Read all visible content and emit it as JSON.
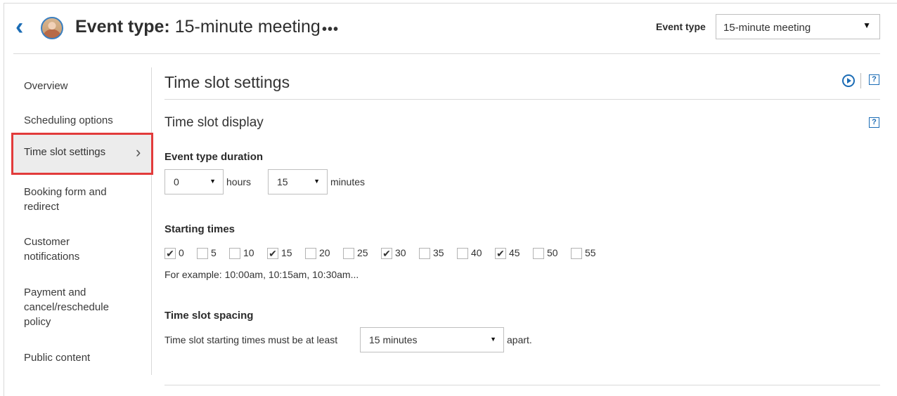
{
  "header": {
    "title_prefix": "Event type:",
    "title_name": "15-minute meeting",
    "more_label": "•••",
    "event_type_label": "Event type",
    "event_type_value": "15-minute meeting"
  },
  "sidebar": {
    "items": [
      {
        "label": "Overview"
      },
      {
        "label": "Scheduling options"
      },
      {
        "label": "Time slot settings",
        "active": true
      },
      {
        "label": "Booking form and redirect"
      },
      {
        "label": "Customer notifications"
      },
      {
        "label": "Payment and cancel/reschedule policy"
      },
      {
        "label": "Public content"
      }
    ]
  },
  "main": {
    "section_title": "Time slot settings",
    "subsection_title": "Time slot display",
    "duration": {
      "label": "Event type duration",
      "hours_value": "0",
      "hours_unit": "hours",
      "minutes_value": "15",
      "minutes_unit": "minutes"
    },
    "starting_times": {
      "label": "Starting times",
      "options": [
        {
          "value": "0",
          "checked": true
        },
        {
          "value": "5",
          "checked": false
        },
        {
          "value": "10",
          "checked": false
        },
        {
          "value": "15",
          "checked": true
        },
        {
          "value": "20",
          "checked": false
        },
        {
          "value": "25",
          "checked": false
        },
        {
          "value": "30",
          "checked": true
        },
        {
          "value": "35",
          "checked": false
        },
        {
          "value": "40",
          "checked": false
        },
        {
          "value": "45",
          "checked": true
        },
        {
          "value": "50",
          "checked": false
        },
        {
          "value": "55",
          "checked": false
        }
      ],
      "example": "For example: 10:00am, 10:15am, 10:30am..."
    },
    "spacing": {
      "label": "Time slot spacing",
      "prefix": "Time slot starting times must be at least",
      "value": "15 minutes",
      "suffix": "apart."
    }
  },
  "icons": {
    "back": "chevron-left-icon",
    "play": "play-circle-icon",
    "help": "help-question-icon",
    "accent_color": "#1b6cb5",
    "highlight_color": "#e23b3b"
  }
}
